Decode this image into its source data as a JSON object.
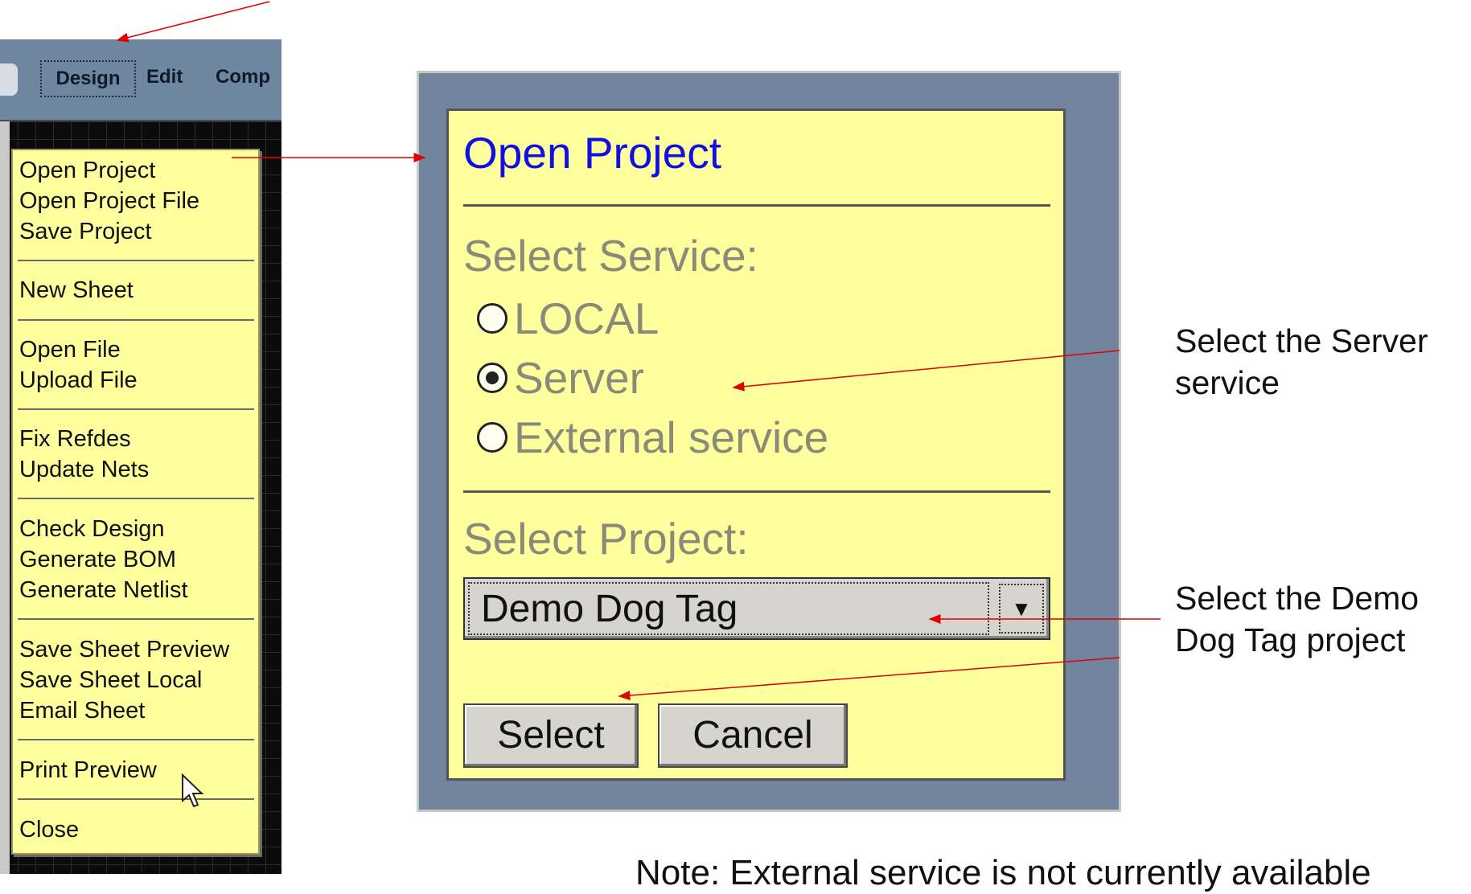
{
  "menubar": {
    "items": [
      {
        "label": "Design"
      },
      {
        "label": "Edit"
      },
      {
        "label": "Comp"
      }
    ]
  },
  "design_menu": {
    "items": [
      "Open Project",
      "Open Project File",
      "Save Project",
      "New Sheet",
      "Open File",
      "Upload File",
      "Fix Refdes",
      "Update Nets",
      "Check Design",
      "Generate BOM",
      "Generate Netlist",
      "Save Sheet Preview",
      "Save Sheet Local",
      "Email Sheet",
      "Print Preview",
      "Close"
    ]
  },
  "dialog": {
    "title": "Open Project",
    "service_label": "Select Service:",
    "services": [
      {
        "label": "LOCAL",
        "checked": false
      },
      {
        "label": "Server",
        "checked": true
      },
      {
        "label": "External service",
        "checked": false
      }
    ],
    "project_label": "Select Project:",
    "project_value": "Demo Dog Tag",
    "select_label": "Select",
    "cancel_label": "Cancel"
  },
  "annotations": {
    "server_callout_line1": "Select the Server",
    "server_callout_line2": "service",
    "project_callout_line1": "Select the Demo",
    "project_callout_line2": "Dog Tag project",
    "note": "Note: External service is not currently available"
  },
  "colors": {
    "menu_bg": "#ffff9e",
    "menubar_bg": "#6f86a0",
    "title_blue": "#1010e0",
    "arrow_red": "#e00000"
  }
}
